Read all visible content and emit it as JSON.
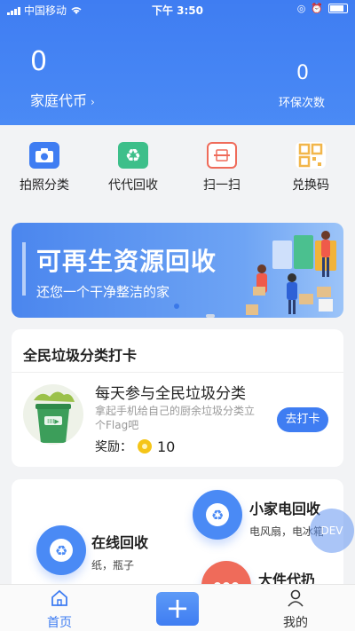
{
  "status_bar": {
    "carrier": "中国移动",
    "time": "下午 3:50"
  },
  "header": {
    "coin_value": "0",
    "coin_label": "家庭代币",
    "eco_value": "0",
    "eco_label": "环保次数"
  },
  "actions": [
    {
      "label": "拍照分类",
      "icon": "camera-icon",
      "color": "#3f7df2"
    },
    {
      "label": "代代回收",
      "icon": "recycle-icon",
      "color": "#3dbf8a"
    },
    {
      "label": "扫一扫",
      "icon": "scan-icon",
      "color": "#ef6b5a"
    },
    {
      "label": "兑换码",
      "icon": "qrcode-icon",
      "color": "#f2b64a"
    }
  ],
  "banner": {
    "title": "可再生资源回收",
    "subtitle": "还您一个干净整洁的家"
  },
  "checkin": {
    "title": "全民垃圾分类打卡",
    "task_title": "每天参与全民垃圾分类",
    "task_desc": "拿起手机给自己的厨余垃圾分类立个Flag吧",
    "reward_label": "奖励：",
    "reward_value": "10",
    "button": "去打卡"
  },
  "services": [
    {
      "name": "小家电回收",
      "desc": "电风扇，电冰箱",
      "icon": "recycle-icon"
    },
    {
      "name": "在线回收",
      "desc": "纸，瓶子",
      "icon": "recycle-icon"
    },
    {
      "name": "大件代扔",
      "desc": "",
      "icon": "dots-icon"
    }
  ],
  "dev_badge": "DEV",
  "tabbar": {
    "home": "首页",
    "me": "我的"
  }
}
